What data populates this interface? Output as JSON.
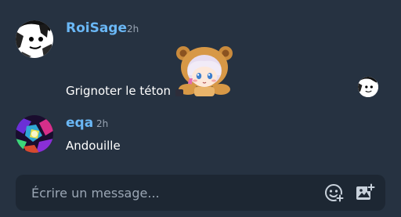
{
  "messages": [
    {
      "author": "RoiSage",
      "time": "2h",
      "text": "Grignoter le téton",
      "avatar_icon": "monochrome-character-avatar",
      "sticker_icon": "anime-girl-bear-hood-sticker",
      "read_by_icon": "monochrome-character-avatar"
    },
    {
      "author": "eqa",
      "time": "2h",
      "text": "Andouille",
      "avatar_icon": "colorful-abstract-avatar"
    }
  ],
  "composer": {
    "placeholder": "Écrire un message...",
    "sticker_button_icon": "sticker-add-icon",
    "image_button_icon": "image-add-icon"
  },
  "colors": {
    "background": "#263241",
    "composer_background": "#1d2733",
    "author_name": "#6ab7f5",
    "timestamp": "#98a4b3",
    "message_text": "#ffffff"
  }
}
